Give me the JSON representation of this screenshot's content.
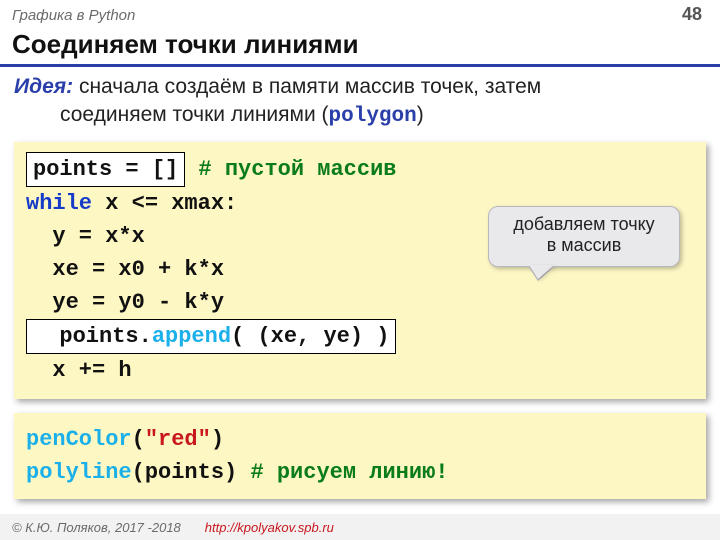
{
  "header": {
    "subject": "Графика в Python",
    "page": "48"
  },
  "title": "Соединяем точки линиями",
  "idea": {
    "label": "Идея:",
    "line1_a": " сначала создаём в памяти массив точек, затем",
    "line2_a": "соединяем точки линиями (",
    "kw": "polygon",
    "line2_b": ")"
  },
  "code1": {
    "l1_hl": "points = []",
    "l1_cmt": " # пустой массив",
    "l2_kw": "while",
    "l2_rest": " x <= xmax:",
    "l3": "  y = x*x",
    "l4": "  xe = x0 + k*x",
    "l5": "  ye = y0 - k*y",
    "l6_pre": "  points.",
    "l6_fn": "append",
    "l6_post": "( (xe, ye) )",
    "l7": "  x += h"
  },
  "callout": {
    "l1": "добавляем точку",
    "l2": "в массив"
  },
  "code2": {
    "l1_fn": "penColor",
    "l1_open": "(",
    "l1_arg": "\"red\"",
    "l1_close": ")",
    "l2_fn": "polyline",
    "l2_rest": "(points) ",
    "l2_cmt": "# рисуем линию!"
  },
  "footer": {
    "copy": "© К.Ю. Поляков, 2017 -2018",
    "url": "http://kpolyakov.spb.ru"
  }
}
